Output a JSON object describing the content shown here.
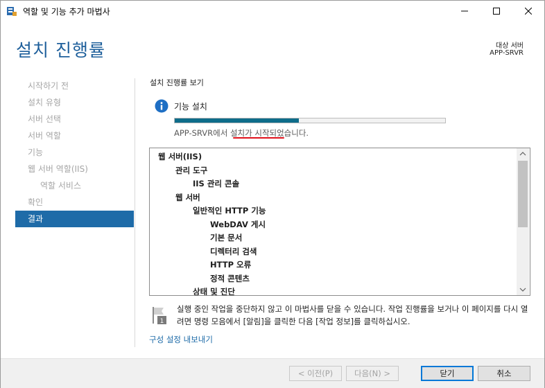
{
  "window": {
    "title": "역할 및 기능 추가 마법사"
  },
  "header": {
    "page_title": "설치 진행률",
    "destination_label": "대상 서버",
    "destination_server": "APP-SRVR"
  },
  "nav": {
    "items": [
      {
        "label": "시작하기 전",
        "active": false,
        "sub": false
      },
      {
        "label": "설치 유형",
        "active": false,
        "sub": false
      },
      {
        "label": "서버 선택",
        "active": false,
        "sub": false
      },
      {
        "label": "서버 역할",
        "active": false,
        "sub": false
      },
      {
        "label": "기능",
        "active": false,
        "sub": false
      },
      {
        "label": "웹 서버 역할(IIS)",
        "active": false,
        "sub": false
      },
      {
        "label": "역할 서비스",
        "active": false,
        "sub": true
      },
      {
        "label": "확인",
        "active": false,
        "sub": false
      },
      {
        "label": "결과",
        "active": true,
        "sub": false
      }
    ]
  },
  "main": {
    "section_label": "설치 진행률 보기",
    "feature_install_label": "기능 설치",
    "progress_fraction": 0.46,
    "status_text": "APP-SRVR에서 설치가 시작되었습니다.",
    "results": [
      {
        "label": "웹 서버(IIS)",
        "level": 0
      },
      {
        "label": "관리 도구",
        "level": 1
      },
      {
        "label": "IIS 관리 콘솔",
        "level": 2
      },
      {
        "label": "웹 서버",
        "level": 1
      },
      {
        "label": "일반적인 HTTP 기능",
        "level": 2
      },
      {
        "label": "WebDAV 게시",
        "level": 3
      },
      {
        "label": "기본 문서",
        "level": 3
      },
      {
        "label": "디렉터리 검색",
        "level": 3
      },
      {
        "label": "HTTP 오류",
        "level": 3
      },
      {
        "label": "정적 콘텐츠",
        "level": 3
      },
      {
        "label": "상태 및 진단",
        "level": 2
      }
    ],
    "notice": "실행 중인 작업을 중단하지 않고 이 마법사를 닫을 수 있습니다. 작업 진행률을 보거나 이 페이지를 다시 열려면 명령 모음에서 [알림]을 클릭한 다음 [작업 정보]를 클릭하십시오.",
    "export_link": "구성 설정 내보내기"
  },
  "footer": {
    "prev_label": "< 이전(P)",
    "next_label": "다음(N) >",
    "close_label": "닫기",
    "cancel_label": "취소"
  },
  "colors": {
    "accent": "#1e6ba8",
    "title_blue": "#1e5f9b",
    "progress": "#0e6d8a",
    "highlight_underline": "#e0101a"
  },
  "icons": {
    "app": "server-manager-icon",
    "info": "info-icon",
    "notice": "flag-icon"
  }
}
